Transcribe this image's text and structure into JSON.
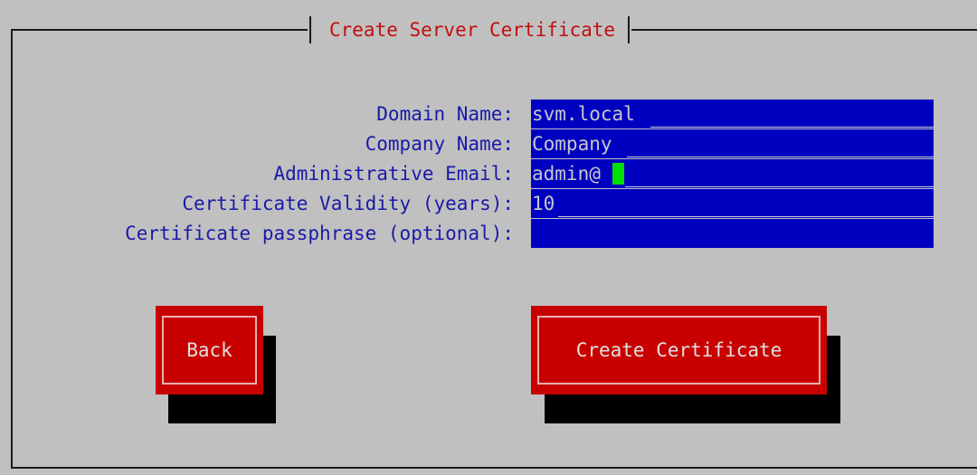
{
  "dialog": {
    "title": "Create Server Certificate"
  },
  "form": {
    "fields": [
      {
        "label": "Domain Name:",
        "value": "svm.local"
      },
      {
        "label": "Company Name:",
        "value": "Company"
      },
      {
        "label": "Administrative Email:",
        "value": "admin@"
      },
      {
        "label": "Certificate Validity (years):",
        "value": "10"
      },
      {
        "label": "Certificate passphrase (optional):",
        "value": ""
      }
    ]
  },
  "buttons": {
    "back_label": "Back",
    "create_label": "Create Certificate"
  },
  "colors": {
    "background": "#c0c0c0",
    "title_text": "#c01010",
    "label_text": "#1a1aa8",
    "input_background": "#0000c0",
    "input_text": "#c8c8c8",
    "cursor": "#00e000",
    "button_background": "#c80000",
    "button_shadow": "#000000"
  }
}
